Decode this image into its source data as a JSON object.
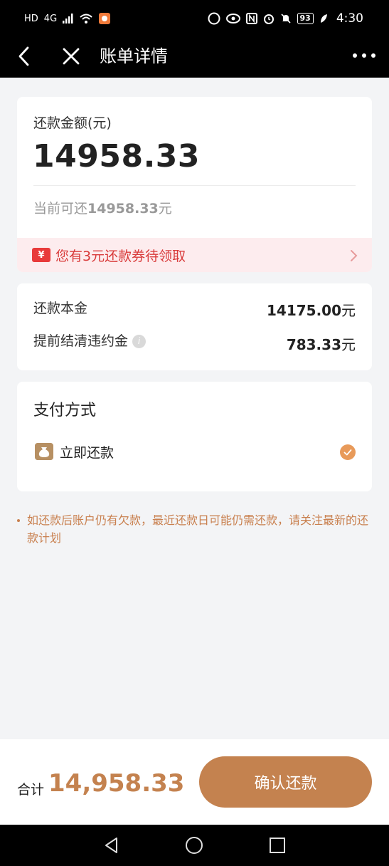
{
  "status_bar": {
    "left_glyphs": [
      "HD",
      "4G",
      "signal",
      "wifi",
      "app"
    ],
    "battery": "93",
    "time": "4:30"
  },
  "header": {
    "title": "账单详情"
  },
  "amount_card": {
    "label": "还款金额(元)",
    "value": "14958.33",
    "current_prefix": "当前可还",
    "current_amount": "14958.33",
    "current_suffix": "元",
    "coupon_icon": "¥",
    "coupon_text": "您有3元还款券待领取"
  },
  "detail_card": {
    "rows": [
      {
        "label": "还款本金",
        "value": "14175.00",
        "unit": "元"
      },
      {
        "label": "提前结清违约金",
        "value": "783.33",
        "unit": "元",
        "info_icon": "i"
      }
    ]
  },
  "payment_card": {
    "title": "支付方式",
    "method": "立即还款",
    "selected": true
  },
  "notice": "如还款后账户仍有欠款，最近还款日可能仍需还款，请关注最新的还款计划",
  "bottom_bar": {
    "total_label": "合计",
    "total_value": "14,958.33",
    "confirm_label": "确认还款"
  },
  "colors": {
    "accent": "#c4824f",
    "coupon_red": "#d93b3b",
    "notice": "#c9804f",
    "background": "#f3f4f6"
  }
}
